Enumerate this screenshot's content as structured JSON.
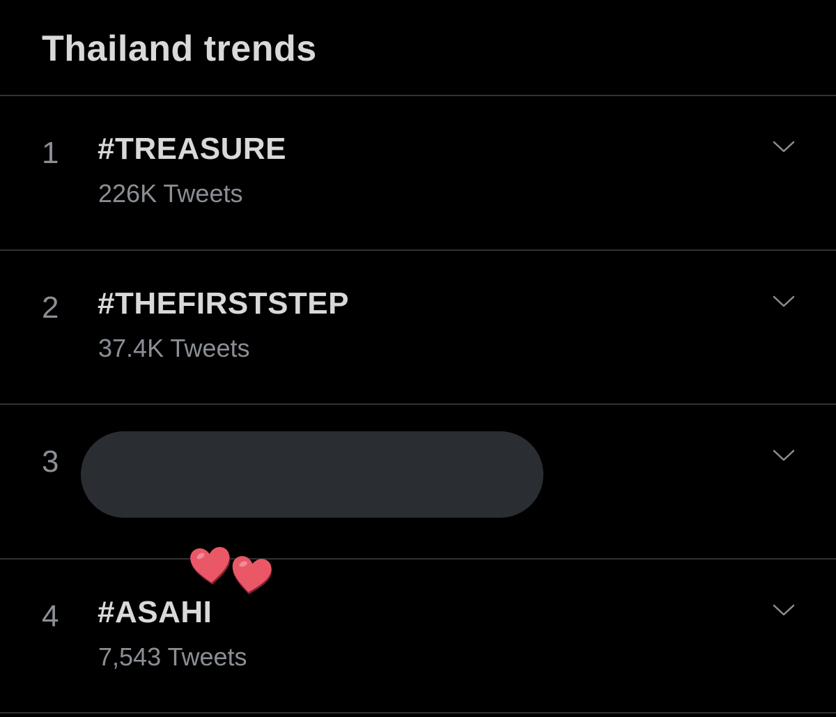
{
  "header": {
    "title": "Thailand trends"
  },
  "trends": [
    {
      "rank": "1",
      "name": "#TREASURE",
      "count": "226K Tweets",
      "redacted": false
    },
    {
      "rank": "2",
      "name": "#THEFIRSTSTEP",
      "count": "37.4K Tweets",
      "redacted": false
    },
    {
      "rank": "3",
      "name": "",
      "count": "",
      "redacted": true
    },
    {
      "rank": "4",
      "name": "#ASAHI",
      "count": "7,543 Tweets",
      "redacted": false
    }
  ],
  "icons": {
    "more": "chevron-down-icon",
    "decoration": "heart-icon"
  },
  "colors": {
    "background": "#000000",
    "title_text": "#d9d9d9",
    "secondary_text": "#8b8f95",
    "divider": "#2f3336",
    "redaction": "#2a2e32",
    "heart": "#ea5868"
  }
}
